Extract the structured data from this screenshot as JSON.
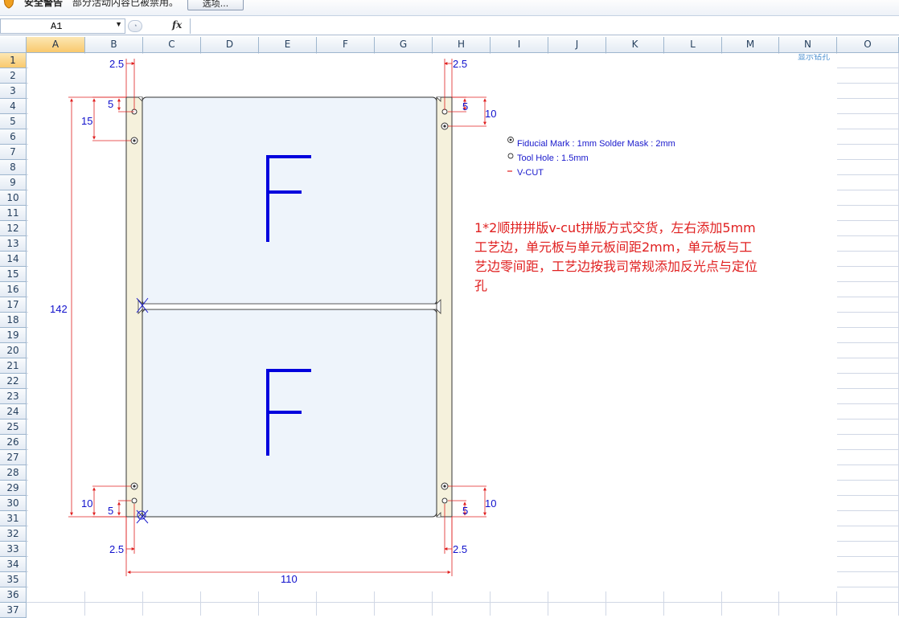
{
  "security_bar": {
    "title": "安全警告",
    "message": "部分活动内容已被禁用。",
    "options_button": "选项..."
  },
  "formula_bar": {
    "name_box": "A1",
    "fx_label": "fx",
    "formula": ""
  },
  "columns": [
    "A",
    "B",
    "C",
    "D",
    "E",
    "F",
    "G",
    "H",
    "I",
    "J",
    "K",
    "L",
    "M",
    "N",
    "O"
  ],
  "rows": [
    "1",
    "2",
    "3",
    "4",
    "5",
    "6",
    "7",
    "8",
    "9",
    "10",
    "11",
    "12",
    "13",
    "14",
    "15",
    "16",
    "17",
    "18",
    "19",
    "20",
    "21",
    "22",
    "23",
    "24",
    "25",
    "26",
    "27",
    "28",
    "29",
    "30",
    "31",
    "32",
    "33",
    "34",
    "35",
    "36",
    "37"
  ],
  "selected_cell": {
    "column": "A",
    "row": "1"
  },
  "drawing": {
    "drill_label": "显示钻孔",
    "panel_letters": [
      "F",
      "F"
    ],
    "dimensions": {
      "top_left_rail": "2.5",
      "top_right_rail": "2.5",
      "top_left_hole": "5",
      "top_left_fiducial": "15",
      "top_right_hole": "5",
      "top_right_fiducial": "10",
      "total_height": "142",
      "bottom_left_fiducial": "10",
      "bottom_left_hole": "5",
      "bottom_right_fiducial": "10",
      "bottom_right_hole": "5",
      "bottom_left_rail": "2.5",
      "bottom_right_rail": "2.5",
      "total_width": "110"
    },
    "legend": {
      "fiducial": "Fiducial Mark : 1mm  Solder Mask : 2mm",
      "tool_hole": "Tool Hole : 1.5mm",
      "vcut": "V-CUT"
    },
    "colors": {
      "dimension": "#1010cc",
      "dim_line": "#e02020",
      "rail_fill": "#f5f1dc",
      "board_fill": "#eef4fb",
      "letter": "#0000dd"
    }
  },
  "note": {
    "lines": [
      "1*2顺拼拼版v-cut拼版方式交货，左右添加5mm",
      "工艺边，单元板与单元板间距2mm，单元板与工",
      "艺边零间距，工艺边按我司常规添加反光点与定位",
      "孔"
    ]
  }
}
